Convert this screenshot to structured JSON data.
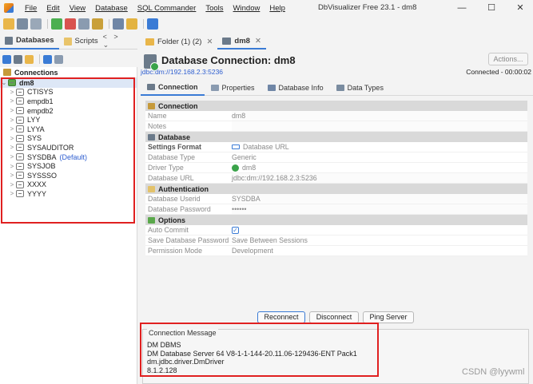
{
  "window": {
    "title": "DbVisualizer Free 23.1 - dm8",
    "menu": [
      "File",
      "Edit",
      "View",
      "Database",
      "SQL Commander",
      "Tools",
      "Window",
      "Help"
    ],
    "controls": {
      "minimize": "—",
      "maximize": "☐",
      "close": "✕"
    }
  },
  "left": {
    "tabs": [
      {
        "label": "Databases"
      },
      {
        "label": "Scripts"
      }
    ],
    "nav": "< > ⌄",
    "tree_header": "Connections",
    "root": "dm8",
    "items": [
      "CTISYS",
      "empdb1",
      "empdb2",
      "LYY",
      "LYYA",
      "SYS",
      "SYSAUDITOR",
      "SYSDBA",
      "SYSJOB",
      "SYSSSO",
      "XXXX",
      "YYYY"
    ],
    "default_badge": "(Default)"
  },
  "right": {
    "tabs": [
      {
        "label": "Folder (1) (2)",
        "close": "✕"
      },
      {
        "label": "dm8",
        "close": "✕"
      }
    ],
    "title": "Database Connection: dm8",
    "url": "jdbc:dm://192.168.2.3:5236",
    "actions": "Actions...",
    "status": "Connected - 00:00:02",
    "sub_tabs": [
      "Connection",
      "Properties",
      "Database Info",
      "Data Types"
    ]
  },
  "form": {
    "connection_section": "Connection",
    "name_label": "Name",
    "name_value": "dm8",
    "notes_label": "Notes",
    "notes_value": "",
    "database_section": "Database",
    "settings_format_label": "Settings Format",
    "settings_format_value": "Database URL",
    "database_type_label": "Database Type",
    "database_type_value": "Generic",
    "driver_type_label": "Driver Type",
    "driver_type_value": "dm8",
    "database_url_label": "Database URL",
    "database_url_value": "jdbc:dm://192.168.2.3:5236",
    "auth_section": "Authentication",
    "userid_label": "Database Userid",
    "userid_value": "SYSDBA",
    "password_label": "Database Password",
    "password_value": "••••••",
    "options_section": "Options",
    "auto_commit_label": "Auto Commit",
    "auto_commit_checked": "✓",
    "save_pw_label": "Save Database Password",
    "save_pw_value": "Save Between Sessions",
    "permission_label": "Permission Mode",
    "permission_value": "Development"
  },
  "buttons": {
    "reconnect": "Reconnect",
    "disconnect": "Disconnect",
    "ping": "Ping Server"
  },
  "message": {
    "legend": "Connection Message",
    "lines": [
      "DM DBMS",
      "DM Database Server 64 V8-1-1-144-20.11.06-129436-ENT Pack1",
      "dm.jdbc.driver.DmDriver",
      "8.1.2.128"
    ]
  },
  "watermark": "CSDN @lyywml",
  "colors": {
    "accent": "#3a7bd5",
    "highlight_box": "#e02020",
    "link": "#2f5fd0",
    "connected": "#3aa34a"
  }
}
